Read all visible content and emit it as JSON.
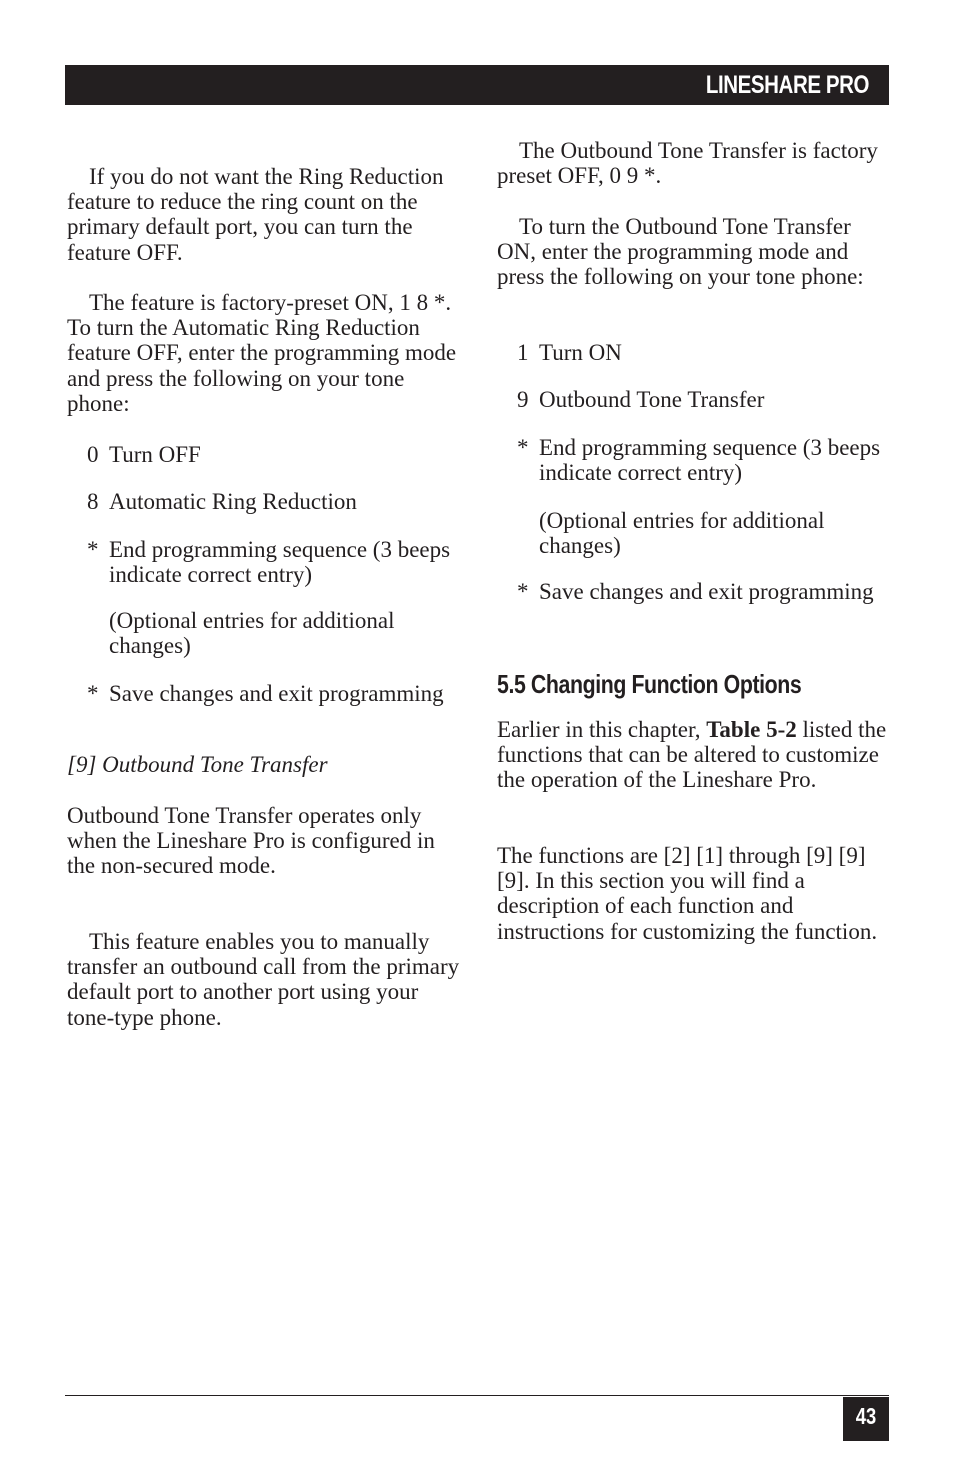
{
  "header": {
    "title": "LINESHARE PRO"
  },
  "left_column": {
    "para1": "If you do not want the Ring Reduction feature to reduce the ring count on the primary default port, you can turn the feature OFF.",
    "para2": "The feature is factory-preset ON, 1 8 *. To turn the Automatic Ring Reduction feature OFF, enter the programming mode and press the following on your tone phone:",
    "steps": [
      {
        "key": "0",
        "text": "Turn OFF"
      },
      {
        "key": "8",
        "text": "Automatic Ring Reduction"
      },
      {
        "key": "*",
        "text": "End programming sequence (3 beeps indicate correct entry)"
      },
      {
        "key": "*",
        "text": "Save changes and exit programming"
      }
    ],
    "optional_note": "(Optional entries for additional changes)",
    "subheading": "[9] Outbound Tone Transfer",
    "para3": "Outbound Tone Transfer operates only when the Lineshare Pro is configured in the non-secured mode.",
    "para4": "This feature enables you to manually transfer an outbound call from the primary default port to another port using your tone-type phone."
  },
  "right_column": {
    "para1": "The Outbound Tone Transfer is factory preset OFF, 0 9 *.",
    "para2": "To turn the Outbound Tone Transfer ON, enter the programming mode and press the following on your tone phone:",
    "steps": [
      {
        "key": "1",
        "text": "Turn ON"
      },
      {
        "key": "9",
        "text": "Outbound Tone Transfer"
      },
      {
        "key": "*",
        "text": "End programming sequence (3 beeps indicate correct entry)"
      },
      {
        "key": "*",
        "text": "Save changes and exit programming"
      }
    ],
    "optional_note": "(Optional entries for additional changes)",
    "section_title": "5.5 Changing Function Options",
    "para3_before": "Earlier in this chapter, ",
    "para3_bold": "Table 5-2",
    "para3_after": " listed the functions that can be altered to customize the operation of the Lineshare Pro.",
    "para4": "The functions are [2] [1] through [9] [9] [9]. In this section you will find a description of each function and instructions for customizing the function."
  },
  "footer": {
    "page_number": "43"
  }
}
